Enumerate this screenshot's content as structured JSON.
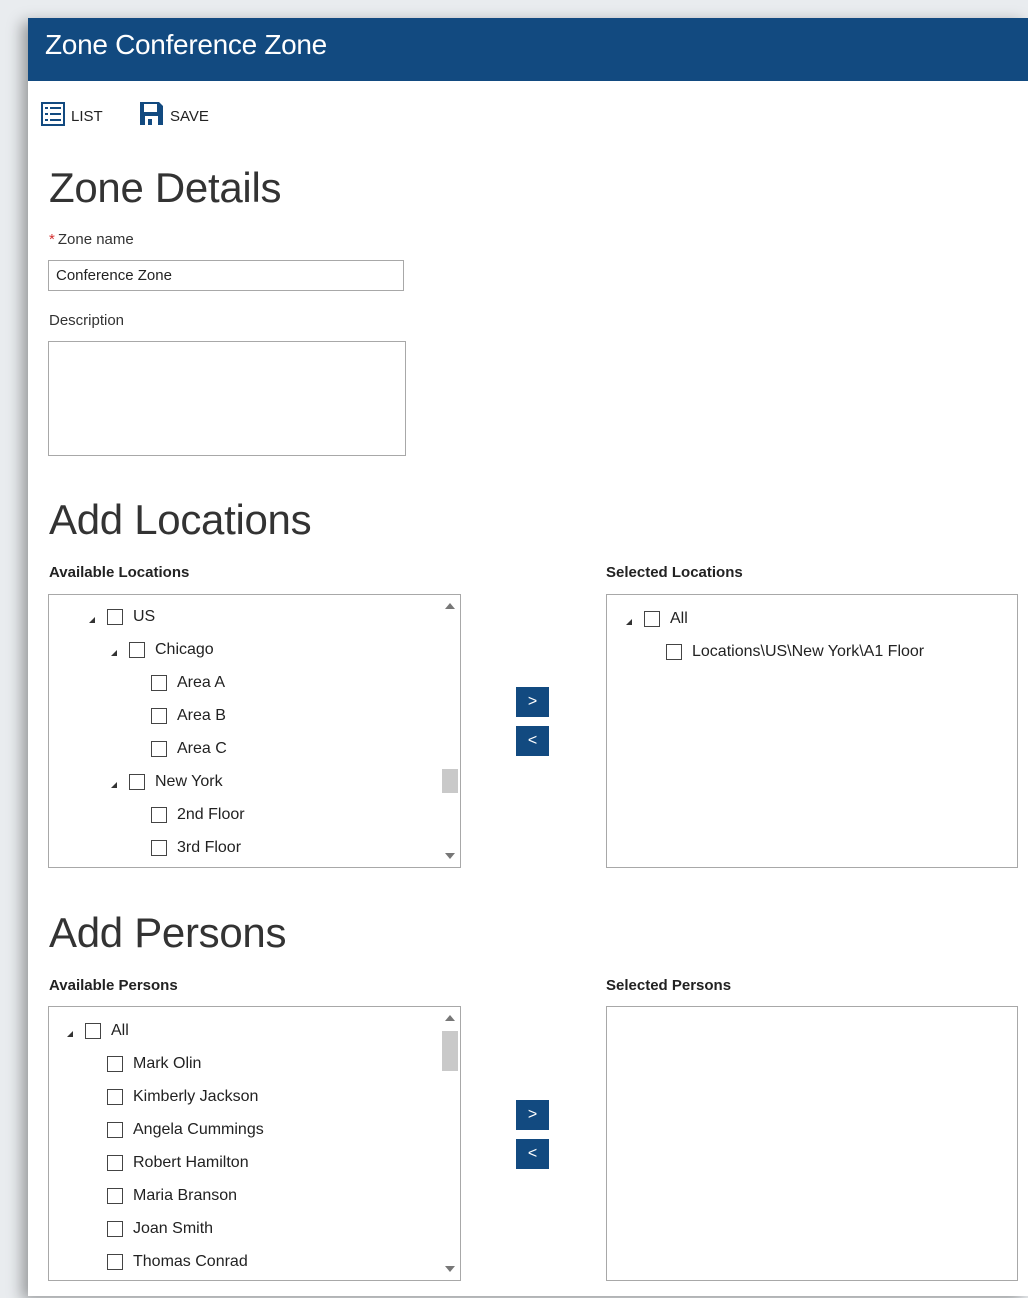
{
  "window": {
    "title": "Zone Conference Zone"
  },
  "toolbar": {
    "list_label": "LIST",
    "save_label": "SAVE"
  },
  "details": {
    "heading": "Zone Details",
    "zone_name_label": "Zone name",
    "zone_name_value": "Conference Zone",
    "description_label": "Description",
    "description_value": ""
  },
  "locations": {
    "heading": "Add Locations",
    "available_label": "Available Locations",
    "selected_label": "Selected Locations",
    "available": [
      {
        "label": "US",
        "level": 0,
        "expanded": true
      },
      {
        "label": "Chicago",
        "level": 1,
        "expanded": true
      },
      {
        "label": "Area A",
        "level": 2
      },
      {
        "label": "Area B",
        "level": 2
      },
      {
        "label": "Area C",
        "level": 2
      },
      {
        "label": "New York",
        "level": 1,
        "expanded": true
      },
      {
        "label": "2nd Floor",
        "level": 2
      },
      {
        "label": "3rd Floor",
        "level": 2
      }
    ],
    "selected": [
      {
        "label": "All",
        "level": 0,
        "expanded": true
      },
      {
        "label": "Locations\\US\\New York\\A1 Floor",
        "level": 1
      }
    ],
    "add_label": ">",
    "remove_label": "<"
  },
  "persons": {
    "heading": "Add Persons",
    "available_label": "Available Persons",
    "selected_label": "Selected Persons",
    "available": [
      {
        "label": "All",
        "level": 0,
        "expanded": true
      },
      {
        "label": "Mark Olin",
        "level": 1
      },
      {
        "label": "Kimberly Jackson",
        "level": 1
      },
      {
        "label": "Angela Cummings",
        "level": 1
      },
      {
        "label": "Robert Hamilton",
        "level": 1
      },
      {
        "label": "Maria Branson",
        "level": 1
      },
      {
        "label": "Joan Smith",
        "level": 1
      },
      {
        "label": "Thomas Conrad",
        "level": 1
      }
    ],
    "selected": [],
    "add_label": ">",
    "remove_label": "<"
  },
  "colors": {
    "brand": "#124a80",
    "required": "#d32f2f"
  }
}
